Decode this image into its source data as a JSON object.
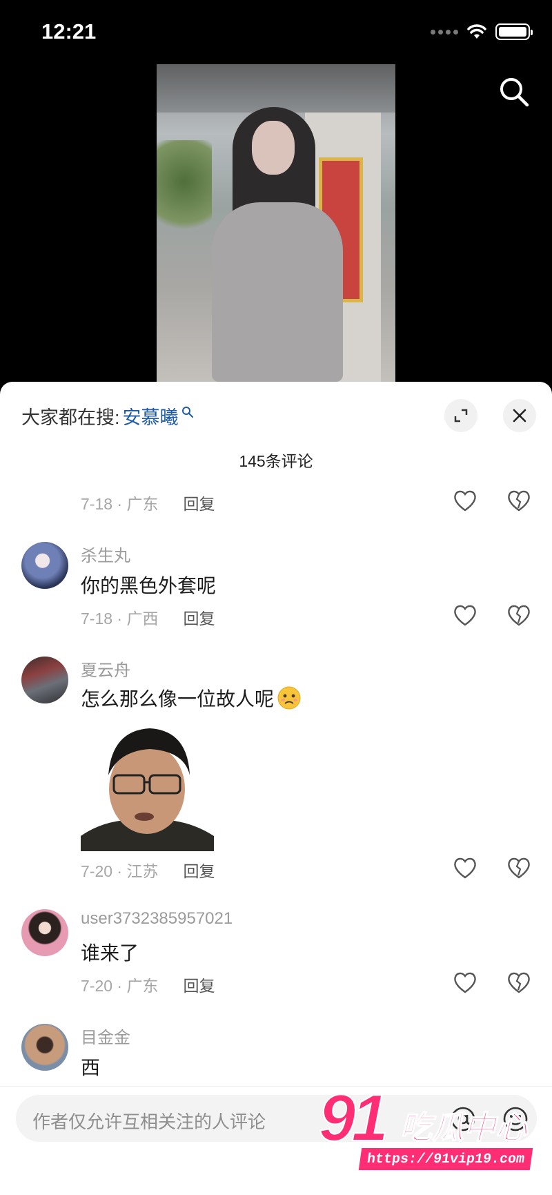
{
  "status_bar": {
    "time": "12:21"
  },
  "hot_search": {
    "prefix": "大家都在搜:",
    "term": "安慕曦"
  },
  "comment_count": "145条评论",
  "comments": [
    {
      "meta_date": "7-18 · 广东",
      "reply": "回复"
    },
    {
      "username": "杀生丸",
      "text": "你的黑色外套呢",
      "meta_date": "7-18 · 广西",
      "reply": "回复"
    },
    {
      "username": "夏云舟",
      "text": "怎么那么像一位故人呢",
      "meta_date": "7-20 · 江苏",
      "reply": "回复"
    },
    {
      "username": "user3732385957021",
      "text": "谁来了",
      "meta_date": "7-20 · 广东",
      "reply": "回复"
    },
    {
      "username": "目金金",
      "text": "西"
    }
  ],
  "input": {
    "placeholder": "作者仅允许互相关注的人评论"
  },
  "watermark": {
    "number": "91",
    "name": "吃瓜中心",
    "url": "https://91vip19.com"
  },
  "icons": {
    "search": "search-icon",
    "expand": "expand-icon",
    "close": "close-icon",
    "like": "heart-icon",
    "dislike": "broken-heart-icon",
    "at": "at-icon",
    "face": "emoji-face-icon"
  },
  "colors": {
    "link": "#1d5aa8",
    "watermark": "#ff2d74"
  }
}
